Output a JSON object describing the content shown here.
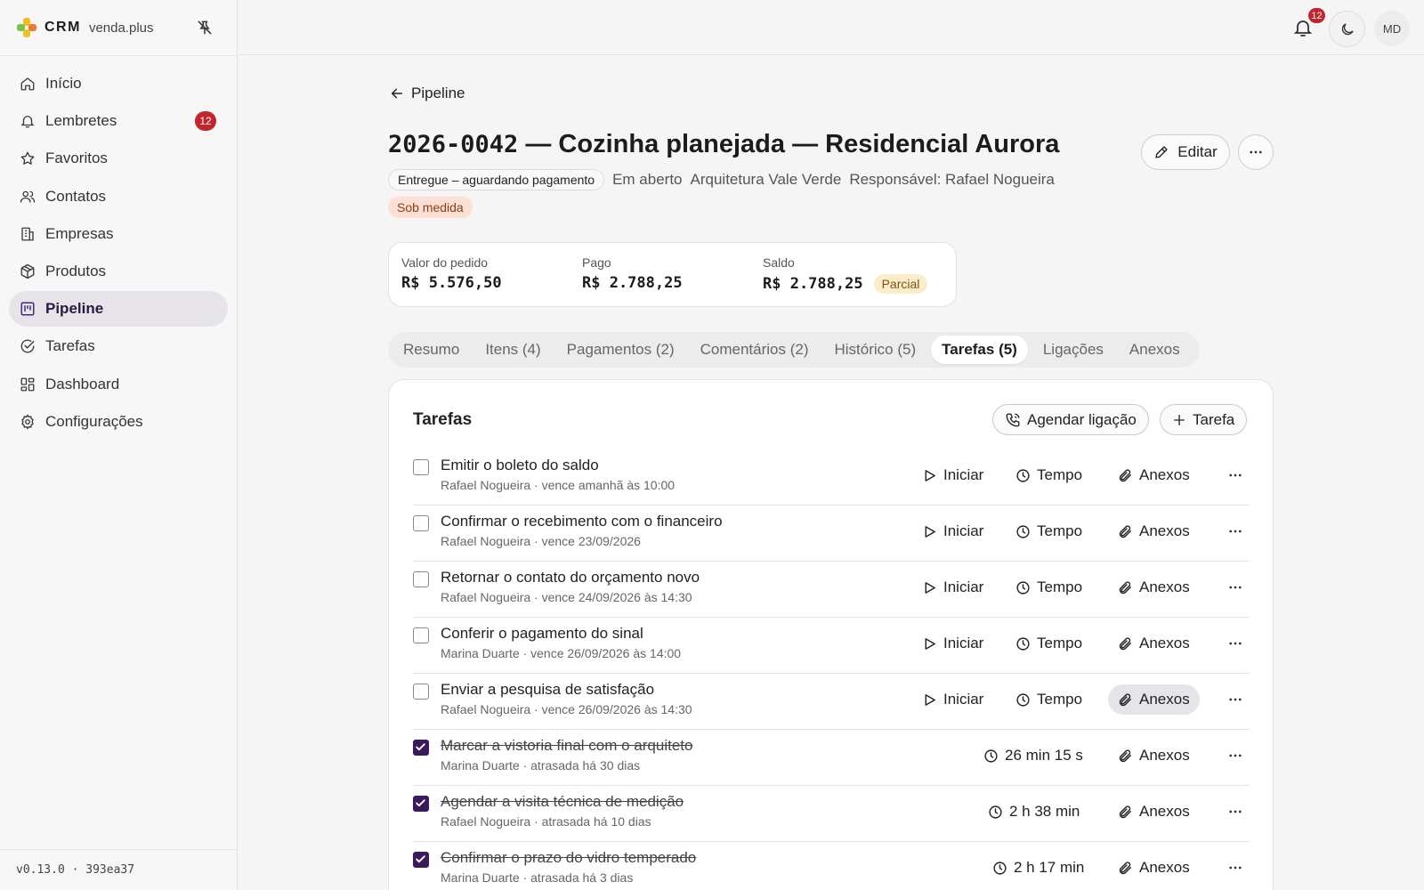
{
  "brand": {
    "name": "CRM",
    "domain": "venda.plus"
  },
  "sidebar": {
    "items": [
      {
        "label": "Início",
        "icon": "home-icon"
      },
      {
        "label": "Lembretes",
        "icon": "bell-icon",
        "badge": "12"
      },
      {
        "label": "Favoritos",
        "icon": "star-icon"
      },
      {
        "label": "Contatos",
        "icon": "users-icon"
      },
      {
        "label": "Empresas",
        "icon": "building-icon"
      },
      {
        "label": "Produtos",
        "icon": "package-icon"
      },
      {
        "label": "Pipeline",
        "icon": "kanban-icon",
        "active": true
      },
      {
        "label": "Tarefas",
        "icon": "check-circle-icon"
      },
      {
        "label": "Dashboard",
        "icon": "dashboard-icon"
      },
      {
        "label": "Configurações",
        "icon": "gear-icon"
      }
    ],
    "version": "v0.13.0 · 393ea37"
  },
  "topbar": {
    "notifications": "12",
    "avatar": "MD"
  },
  "deal": {
    "back_label": "Pipeline",
    "code": "2026-0042",
    "title_rest": " — Cozinha planejada — Residencial Aurora",
    "stage": "Entregue – aguardando pagamento",
    "status": "Em aberto",
    "company": "Arquitetura Vale Verde",
    "owner": "Responsável: Rafael Nogueira",
    "tag": "Sob medida",
    "edit_label": "Editar"
  },
  "summary": {
    "order_label": "Valor do pedido",
    "order_value": "R$ 5.576,50",
    "paid_label": "Pago",
    "paid_value": "R$ 2.788,25",
    "balance_label": "Saldo",
    "balance_value": "R$ 2.788,25",
    "balance_badge": "Parcial"
  },
  "tabs": [
    {
      "label": "Resumo"
    },
    {
      "label": "Itens (4)"
    },
    {
      "label": "Pagamentos (2)"
    },
    {
      "label": "Comentários (2)"
    },
    {
      "label": "Histórico (5)"
    },
    {
      "label": "Tarefas (5)",
      "active": true
    },
    {
      "label": "Ligações"
    },
    {
      "label": "Anexos"
    }
  ],
  "tasks_panel": {
    "title": "Tarefas",
    "schedule_call_label": "Agendar ligação",
    "new_task_label": "Tarefa",
    "start_label": "Iniciar",
    "time_label": "Tempo",
    "attachments_label": "Anexos",
    "tasks": [
      {
        "title": "Emitir o boleto do saldo",
        "sub": "Rafael Nogueira · vence amanhã às 10:00",
        "done": false
      },
      {
        "title": "Confirmar o recebimento com o financeiro",
        "sub": "Rafael Nogueira · vence 23/09/2026",
        "done": false
      },
      {
        "title": "Retornar o contato do orçamento novo",
        "sub": "Rafael Nogueira · vence 24/09/2026 às 14:30",
        "done": false
      },
      {
        "title": "Conferir o pagamento do sinal",
        "sub": "Marina Duarte · vence 26/09/2026 às 14:00",
        "done": false
      },
      {
        "title": "Enviar a pesquisa de satisfação",
        "sub": "Rafael Nogueira · vence 26/09/2026 às 14:30",
        "done": false
      },
      {
        "title": "Marcar a vistoria final com o arquiteto",
        "sub": "Marina Duarte · atrasada há 30 dias",
        "done": true,
        "elapsed": "26 min 15 s"
      },
      {
        "title": "Agendar a visita técnica de medição",
        "sub": "Rafael Nogueira · atrasada há 10 dias",
        "done": true,
        "elapsed": "2 h 38 min"
      },
      {
        "title": "Confirmar o prazo do vidro temperado",
        "sub": "Marina Duarte · atrasada há 3 dias",
        "done": true,
        "elapsed": "2 h 17 min"
      }
    ]
  },
  "colors": {
    "accent": "#3b1a5c",
    "badge": "#c0262c",
    "tag_bg": "#fbe0d3",
    "partial_bg": "#fbedc9"
  }
}
